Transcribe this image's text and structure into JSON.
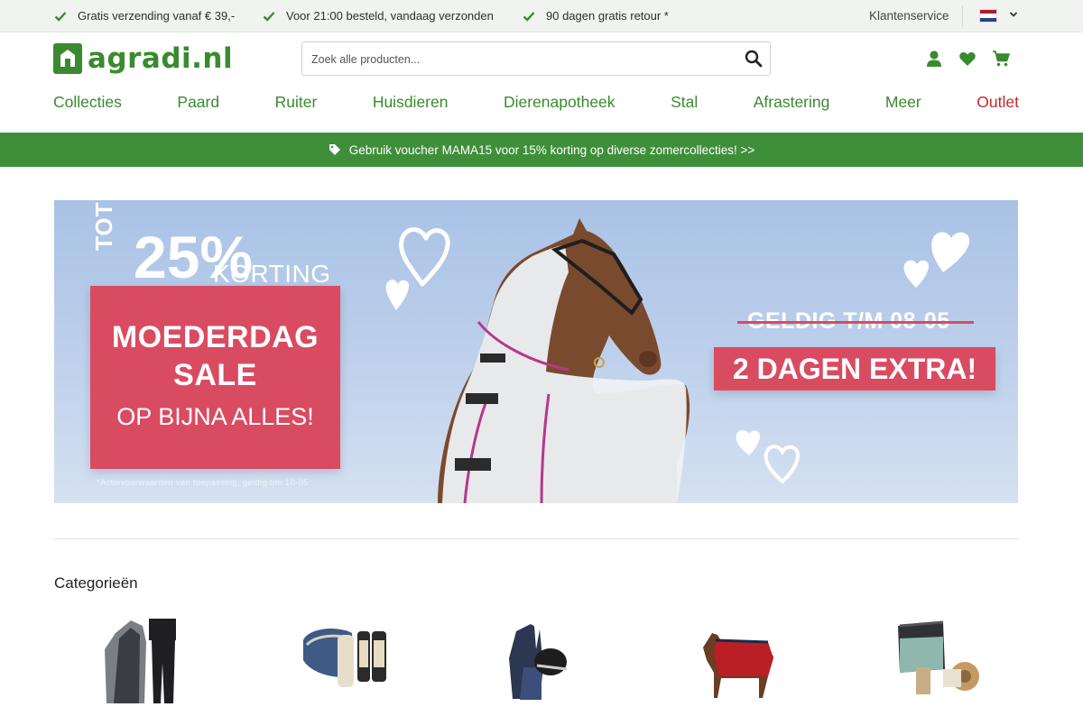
{
  "usp_bar": {
    "items": [
      "Gratis verzending vanaf € 39,-",
      "Voor 21:00 besteld, vandaag verzonden",
      "90 dagen gratis retour *"
    ],
    "icon": "check-icon",
    "customer_service": "Klantenservice",
    "language": {
      "flag": "nl-flag-icon",
      "colors": [
        "#ae1c28",
        "#ffffff",
        "#21468b"
      ]
    }
  },
  "header": {
    "logo_text": "agradi.nl",
    "search_placeholder": "Zoek alle producten...",
    "icons": [
      "search-icon",
      "account-icon",
      "heart-icon",
      "cart-icon"
    ]
  },
  "nav": {
    "items": [
      "Collecties",
      "Paard",
      "Ruiter",
      "Huisdieren",
      "Dierenapotheek",
      "Stal",
      "Afrastering",
      "Meer",
      "Outlet"
    ]
  },
  "voucher": {
    "text": "Gebruik voucher MAMA15 voor 15% korting op diverse zomercollecties! >>",
    "icon": "tag-icon"
  },
  "hero": {
    "tot": "TOT",
    "percent": "25%",
    "korting": "KORTING",
    "title_line1": "MOEDERDAG",
    "title_line2": "SALE",
    "subtitle": "OP BIJNA ALLES!",
    "footnote": "*Actievoorwaarden van toepassing, geldig t/m 10-05",
    "geldig": "GELDIG T/M 08-05",
    "extra": "2 DAGEN EXTRA!"
  },
  "categories": {
    "title": "Categorieën",
    "items": [
      {
        "icon": "clothing-icon"
      },
      {
        "icon": "saddle-pad-icon"
      },
      {
        "icon": "rider-jacket-icon"
      },
      {
        "icon": "horse-blanket-icon"
      },
      {
        "icon": "stable-supplies-icon"
      }
    ]
  },
  "colors": {
    "brand_green": "#3a8a2f",
    "voucher_green": "#3f8f3a",
    "outlet_red": "#c62828",
    "sale_pink": "#d94b61"
  }
}
